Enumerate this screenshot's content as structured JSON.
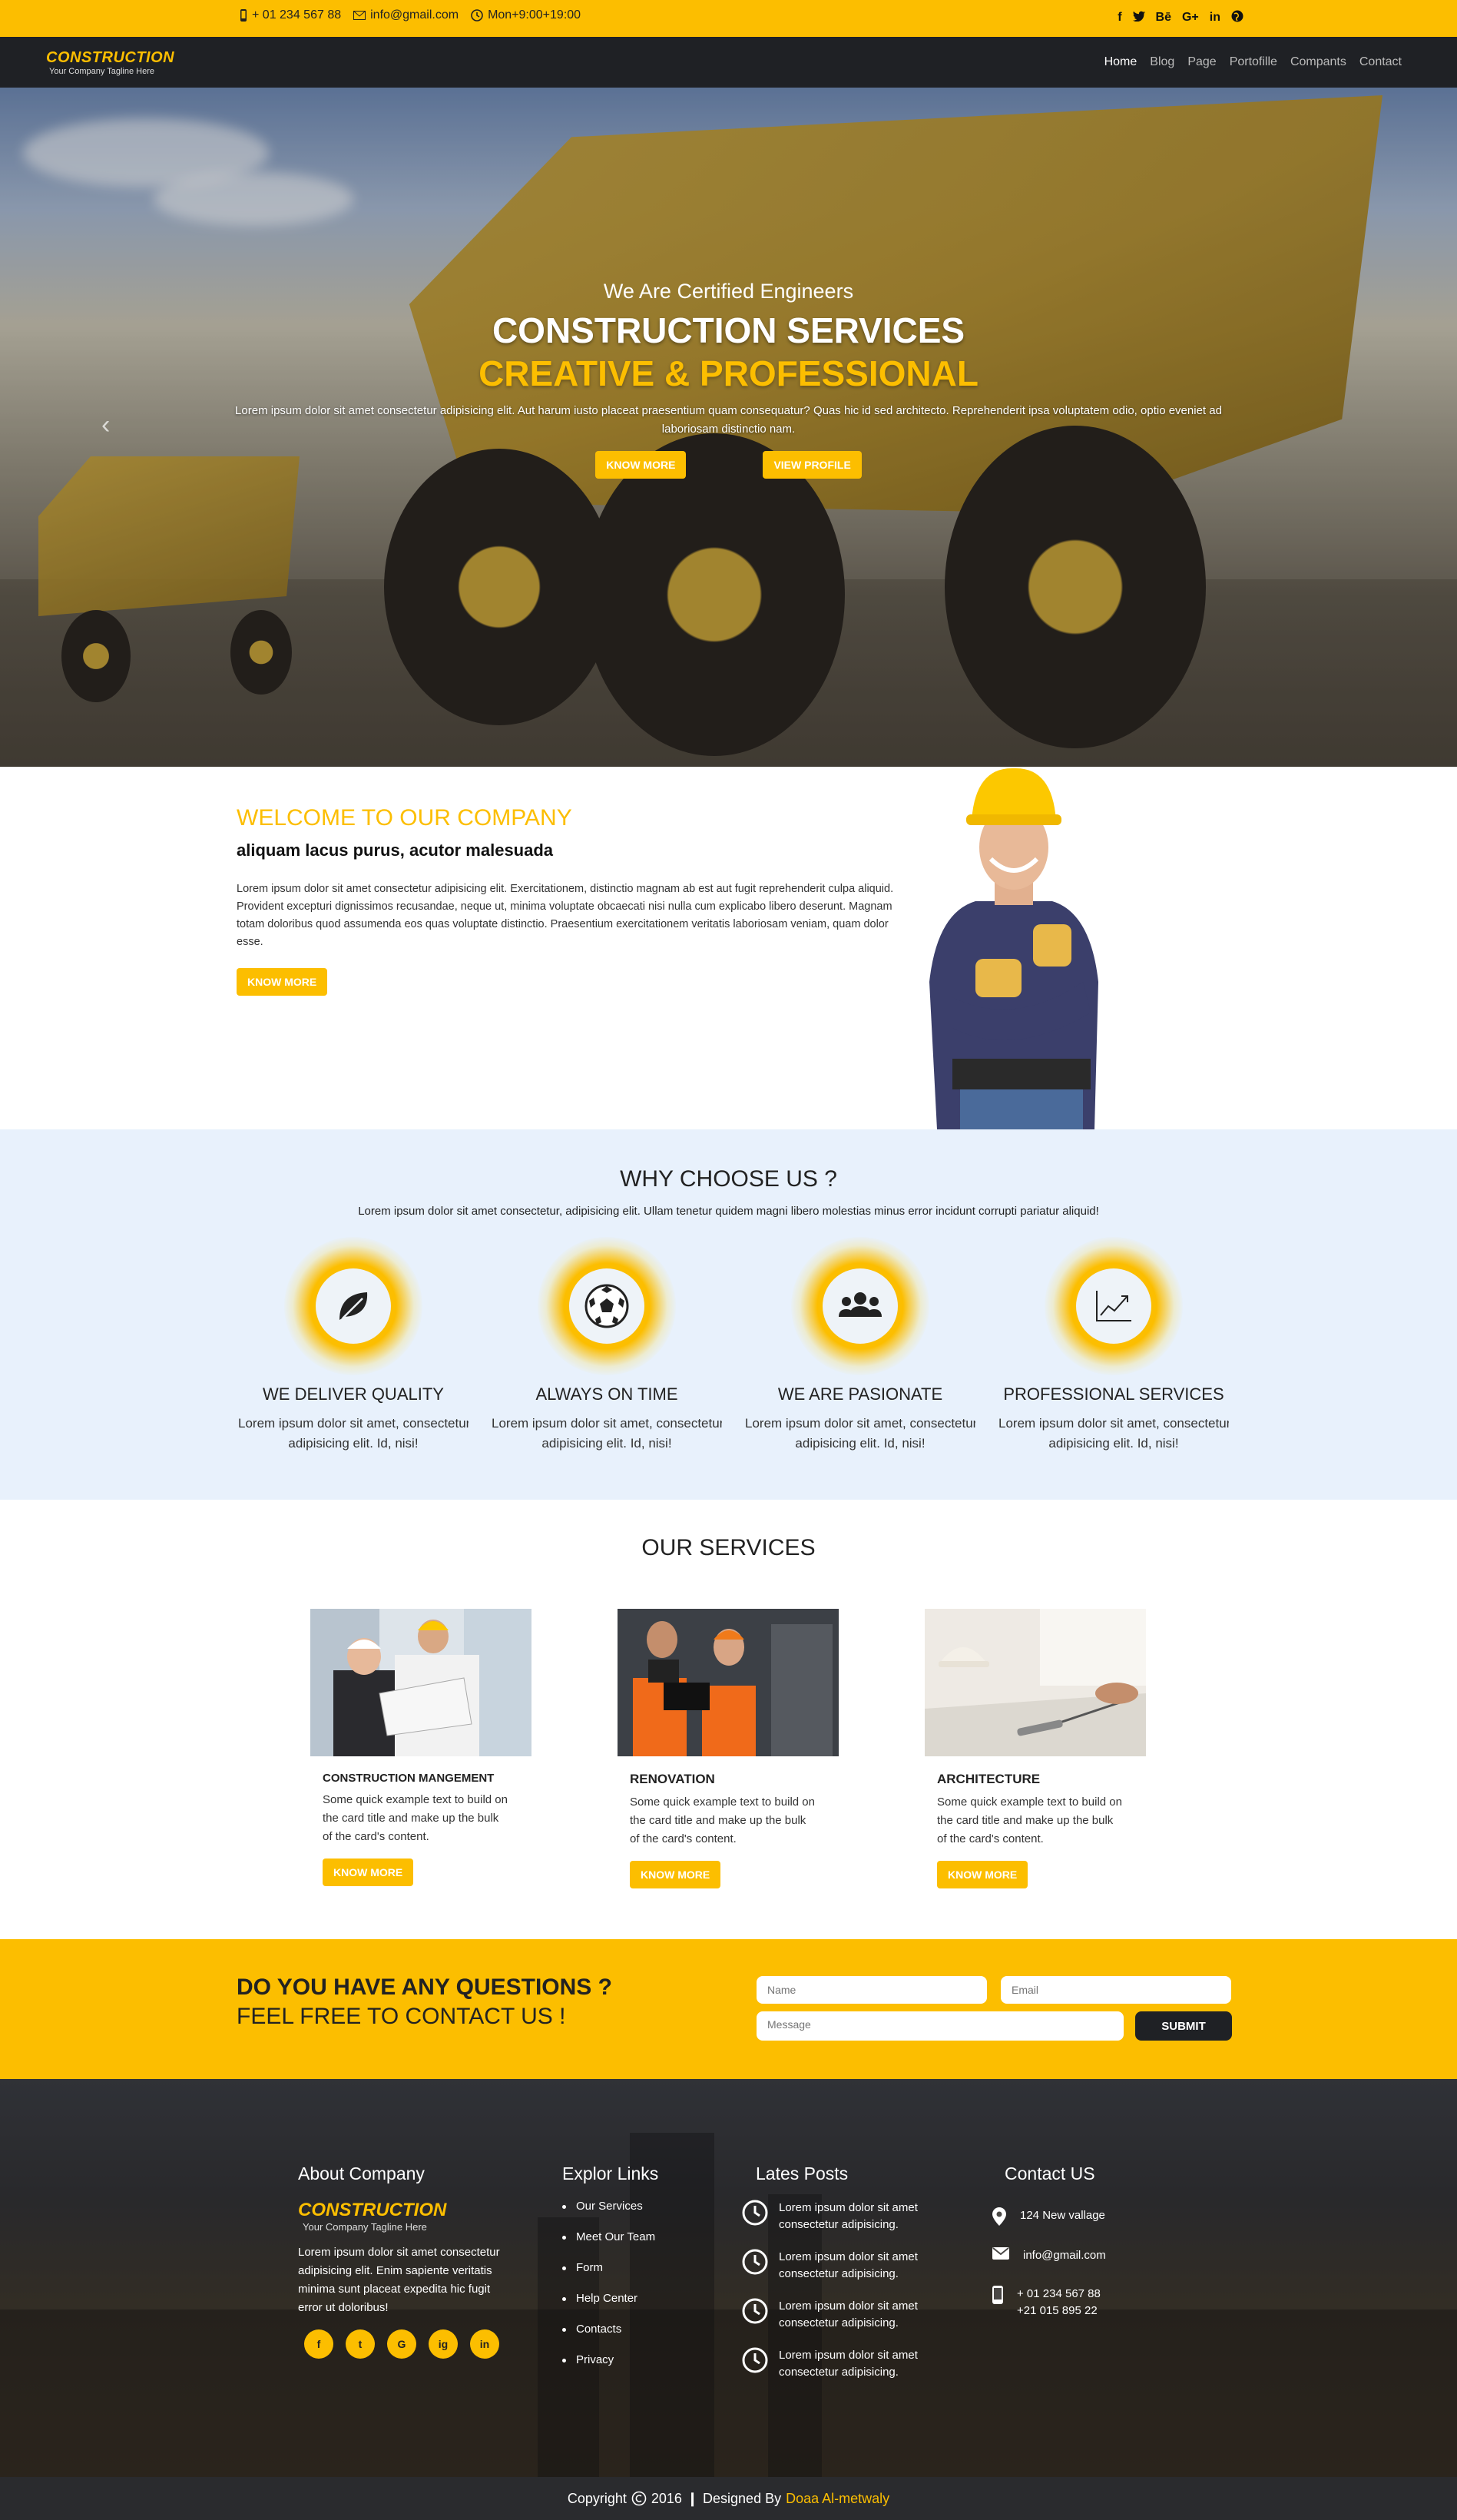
{
  "topbar": {
    "phone": "+ 01 234 567 88",
    "email": "info@gmail.com",
    "hours": "Mon+9:00+19:00",
    "social": [
      "f",
      "t",
      "Bē",
      "G+",
      "in",
      "globe"
    ]
  },
  "nav": {
    "logo": "CONSTRUCTION",
    "tagline": "Your Company Tagline Here",
    "items": [
      "Home",
      "Blog",
      "Page",
      "Portofille",
      "Compants",
      "Contact"
    ]
  },
  "hero": {
    "subtitle": "We Are Certified Engineers",
    "title": "CONSTRUCTION SERVICES",
    "title_accent": "CREATIVE & PROFESSIONAL",
    "description": "Lorem ipsum dolor sit amet consectetur adipisicing elit. Aut harum iusto placeat praesentium quam consequatur? Quas hic id sed architecto. Reprehenderit ipsa voluptatem odio, optio eveniet ad laboriosam distinctio nam.",
    "btn_know": "KNOW MORE",
    "btn_profile": "VIEW PROFILE"
  },
  "welcome": {
    "heading": "WELCOME TO OUR COMPANY",
    "subheading": "aliquam lacus purus, acutor malesuada",
    "text": "Lorem ipsum dolor sit amet consectetur adipisicing elit. Exercitationem, distinctio magnam ab est aut fugit reprehenderit culpa aliquid. Provident excepturi dignissimos recusandae, neque ut, minima voluptate obcaecati nisi nulla cum explicabo libero deserunt. Magnam totam doloribus quod assumenda eos quas voluptate distinctio. Praesentium exercitationem veritatis laboriosam veniam, quam dolor esse.",
    "btn": "KNOW MORE"
  },
  "why": {
    "title": "WHY CHOOSE US ?",
    "intro": "Lorem ipsum dolor sit amet consectetur, adipisicing elit. Ullam tenetur quidem magni libero molestias minus error incidunt corrupti pariatur aliquid!",
    "features": [
      {
        "title": "WE DELIVER QUALITY",
        "line1": "Lorem ipsum dolor sit amet, consectetur",
        "line2": "adipisicing elit. Id, nisi!",
        "icon": "leaf-icon"
      },
      {
        "title": "ALWAYS ON TIME",
        "line1": "Lorem ipsum dolor sit amet, consectetur",
        "line2": "adipisicing elit. Id, nisi!",
        "icon": "soccer-ball-icon"
      },
      {
        "title": "WE ARE PASIONATE",
        "line1": "Lorem ipsum dolor sit amet, consectetur",
        "line2": "adipisicing elit. Id, nisi!",
        "icon": "users-icon"
      },
      {
        "title": "PROFESSIONAL SERVICES",
        "line1": "Lorem ipsum dolor sit amet, consectetur",
        "line2": "adipisicing elit. Id, nisi!",
        "icon": "chart-line-icon"
      }
    ]
  },
  "services": {
    "title": "OUR SERVICES",
    "cards": [
      {
        "title": "CONSTRUCTION MANGEMENT",
        "text": "Some quick example text to build on the card title and make up the bulk of the card's content.",
        "btn": "KNOW MORE"
      },
      {
        "title": "RENOVATION",
        "text": "Some quick example text to build on the card title and make up the bulk of the card's content.",
        "btn": "KNOW MORE"
      },
      {
        "title": "ARCHITECTURE",
        "text": "Some quick example text to build on the card title and make up the bulk of the card's content.",
        "btn": "KNOW MORE"
      }
    ]
  },
  "contact_form": {
    "heading1": "DO YOU HAVE ANY QUESTIONS ?",
    "heading2": "FEEL FREE TO CONTACT US !",
    "name_placeholder": "Name",
    "email_placeholder": "Email",
    "message_placeholder": "Message",
    "submit": "SUBMIT"
  },
  "footer": {
    "about_title": "About Company",
    "about_logo": "CONSTRUCTION",
    "about_tagline": "Your Company Tagline Here",
    "about_text": "Lorem ipsum dolor sit amet consectetur adipisicing elit. Enim sapiente veritatis minima sunt placeat expedita hic fugit error ut doloribus!",
    "social": [
      "f",
      "t",
      "G",
      "ig",
      "in"
    ],
    "links_title": "Explor Links",
    "links": [
      "Our Services",
      "Meet Our Team",
      "Form",
      "Help Center",
      "Contacts",
      "Privacy"
    ],
    "posts_title": "Lates Posts",
    "posts": [
      "Lorem ipsum dolor sit amet consectetur adipisicing.",
      "Lorem ipsum dolor sit amet consectetur adipisicing.",
      "Lorem ipsum dolor sit amet consectetur adipisicing.",
      "Lorem ipsum dolor sit amet consectetur adipisicing."
    ],
    "contact_title": "Contact US",
    "address": "124 New vallage",
    "email": "info@gmail.com",
    "phone1": "+ 01 234 567 88",
    "phone2": "+21 015 895 22"
  },
  "copyright": {
    "text": "Copyright",
    "year": "2016",
    "designed": "Designed By",
    "author": "Doaa Al-metwaly"
  },
  "colors": {
    "accent": "#fcbe00",
    "dark": "#1f2125",
    "light_blue": "#e8f1fc"
  }
}
